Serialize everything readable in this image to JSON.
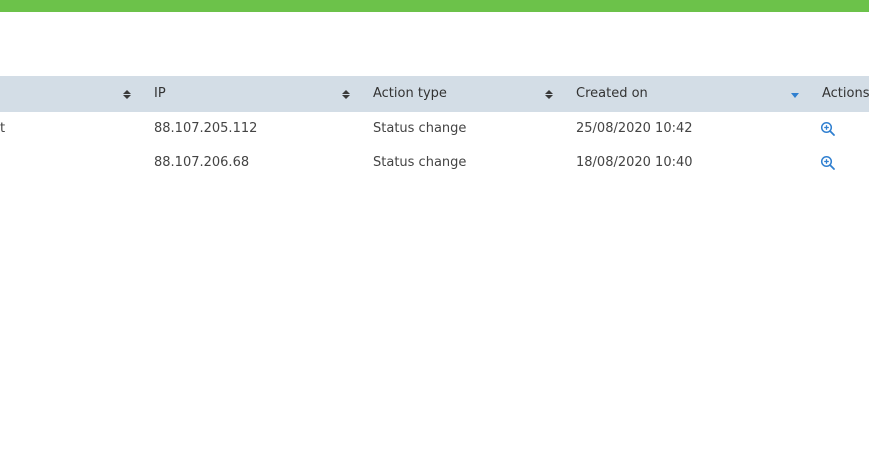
{
  "table": {
    "headers": {
      "ip": "IP",
      "action_type": "Action type",
      "created_on": "Created on",
      "actions": "Actions"
    },
    "rows": [
      {
        "cut_text": "t",
        "ip": "88.107.205.112",
        "action_type": "Status change",
        "created_on": "25/08/2020 10:42"
      },
      {
        "cut_text": "",
        "ip": "88.107.206.68",
        "action_type": "Status change",
        "created_on": "18/08/2020 10:40"
      }
    ]
  },
  "icons": {
    "sort": "sort-both-icon",
    "sort_active": "sort-desc-icon",
    "view": "zoom-in-icon"
  },
  "colors": {
    "top_bar": "#6cc24a",
    "header_bg": "#d3dde6",
    "accent": "#2f7fd0"
  }
}
